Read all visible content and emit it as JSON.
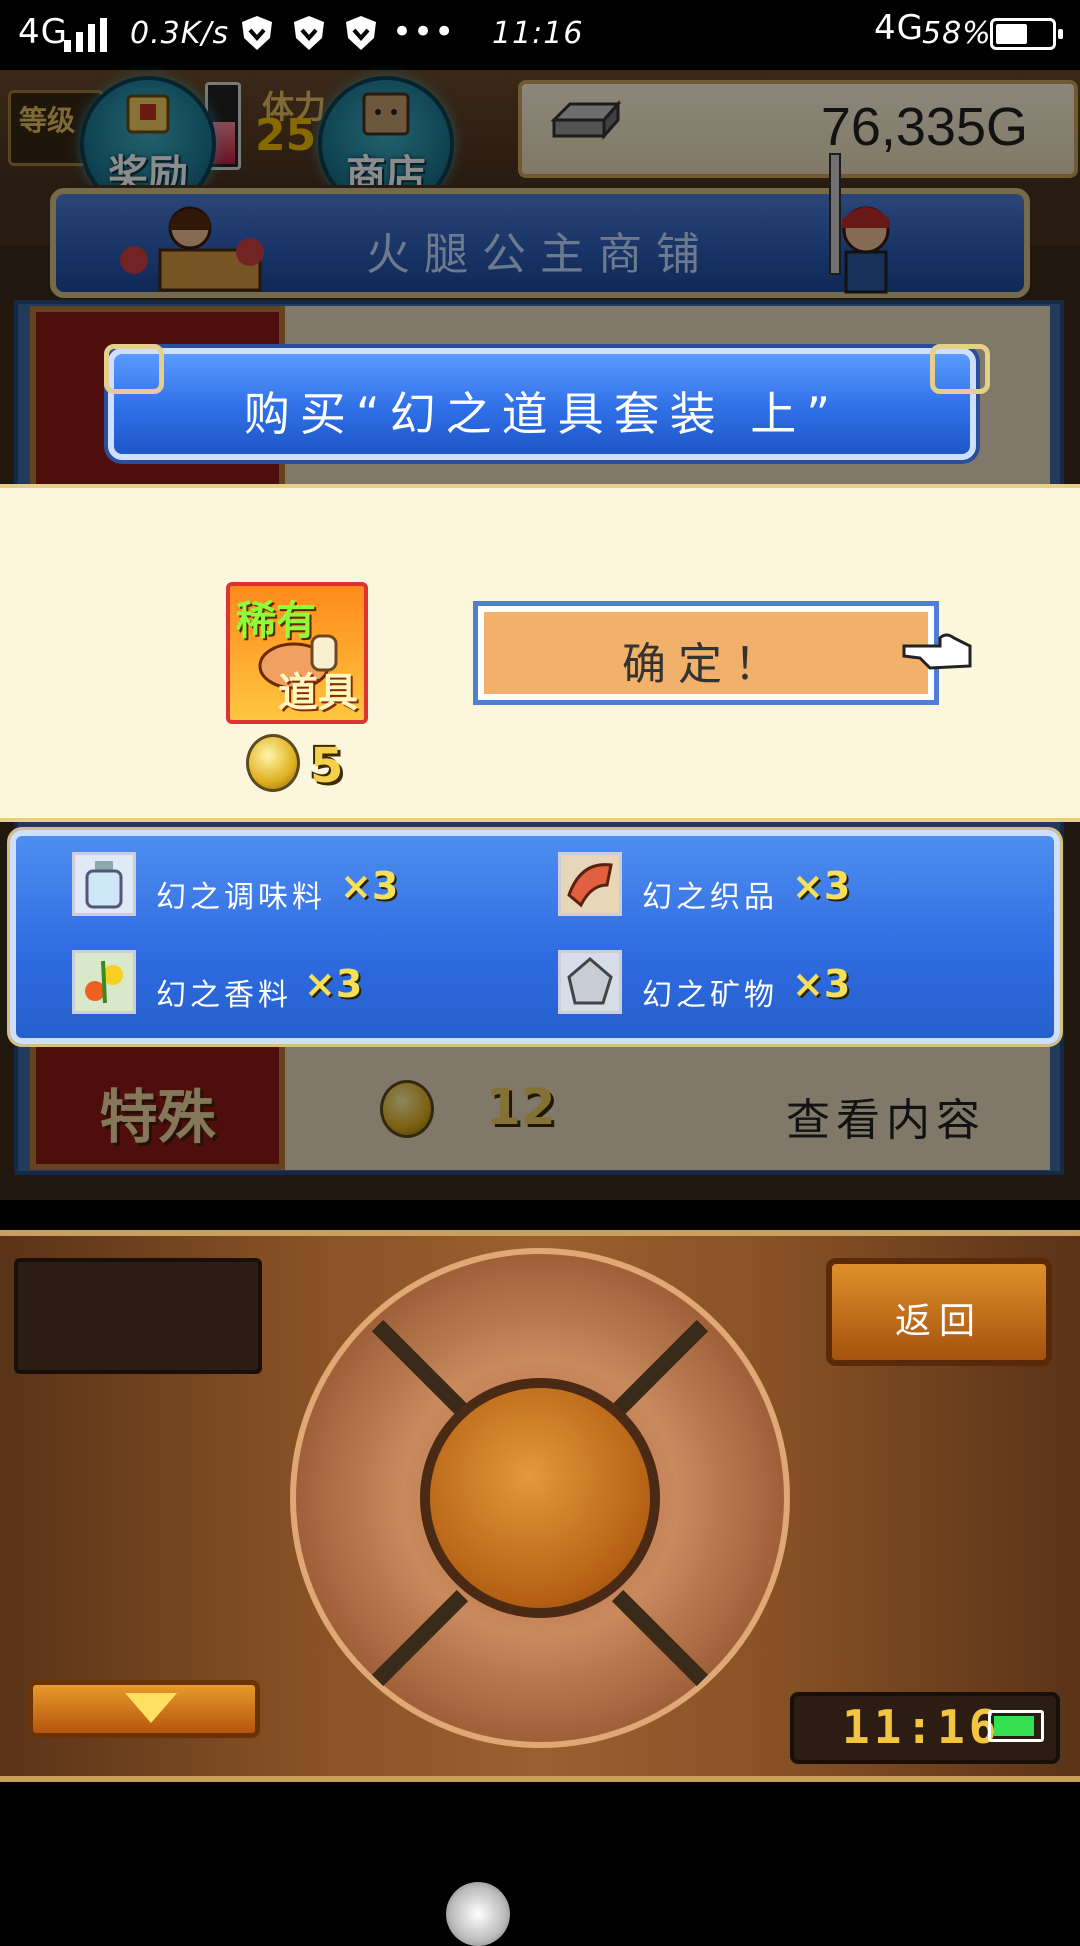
{
  "status_bar": {
    "network_left": "4G",
    "speed": "0.3K/s",
    "more": "•••",
    "time": "11:16",
    "network_right": "4G",
    "battery_percent": "58%",
    "battery_level": 0.58
  },
  "hud": {
    "level_label": "等级",
    "stamina_label": "体力",
    "stamina_value": "25",
    "reward_button": "奖励",
    "shop_button": "商店",
    "gold": "76,335G",
    "hp_level": 0.6
  },
  "shop": {
    "title": "火腿公主商铺",
    "list_items": [
      {
        "tag": "特殊",
        "price": "12",
        "action": "查看内容"
      }
    ]
  },
  "dialog": {
    "title": "购买“幻之道具套装 上”",
    "item_badge_top": "稀有",
    "item_badge_bottom": "道具",
    "price": "5",
    "confirm_label": "确定！",
    "contents": [
      {
        "name": "幻之调味料",
        "qty": "×3",
        "icon": "bottle-icon"
      },
      {
        "name": "幻之织品",
        "qty": "×3",
        "icon": "fabric-icon"
      },
      {
        "name": "幻之香料",
        "qty": "×3",
        "icon": "spice-icon"
      },
      {
        "name": "幻之矿物",
        "qty": "×3",
        "icon": "mineral-icon"
      }
    ]
  },
  "console": {
    "back_label": "返回",
    "clock": "11:16"
  },
  "colors": {
    "accent_blue": "#2f6fe6",
    "gold_text": "#f5d04a",
    "confirm_orange": "#f2b16a"
  }
}
